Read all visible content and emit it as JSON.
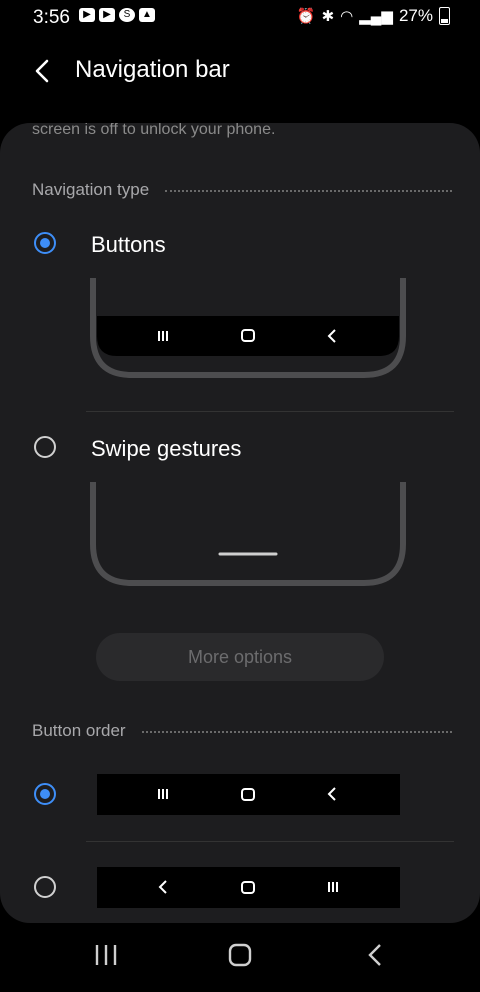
{
  "status_bar": {
    "time": "3:56",
    "battery": "27%"
  },
  "app_bar": {
    "title": "Navigation bar"
  },
  "content": {
    "cut_off_text": "screen is off to unlock your phone.",
    "navigation_type": {
      "header": "Navigation type",
      "options": [
        {
          "label": "Buttons",
          "selected": true
        },
        {
          "label": "Swipe gestures",
          "selected": false
        }
      ],
      "more_options_label": "More options"
    },
    "button_order": {
      "header": "Button order",
      "options": [
        {
          "order": [
            "recents-icon",
            "home-icon",
            "back-icon"
          ],
          "selected": true
        },
        {
          "order": [
            "back-icon",
            "home-icon",
            "recents-icon"
          ],
          "selected": false
        }
      ]
    }
  },
  "colors": {
    "accent": "#3e8ef7",
    "card": "#1d1d1f",
    "background": "#000000"
  }
}
